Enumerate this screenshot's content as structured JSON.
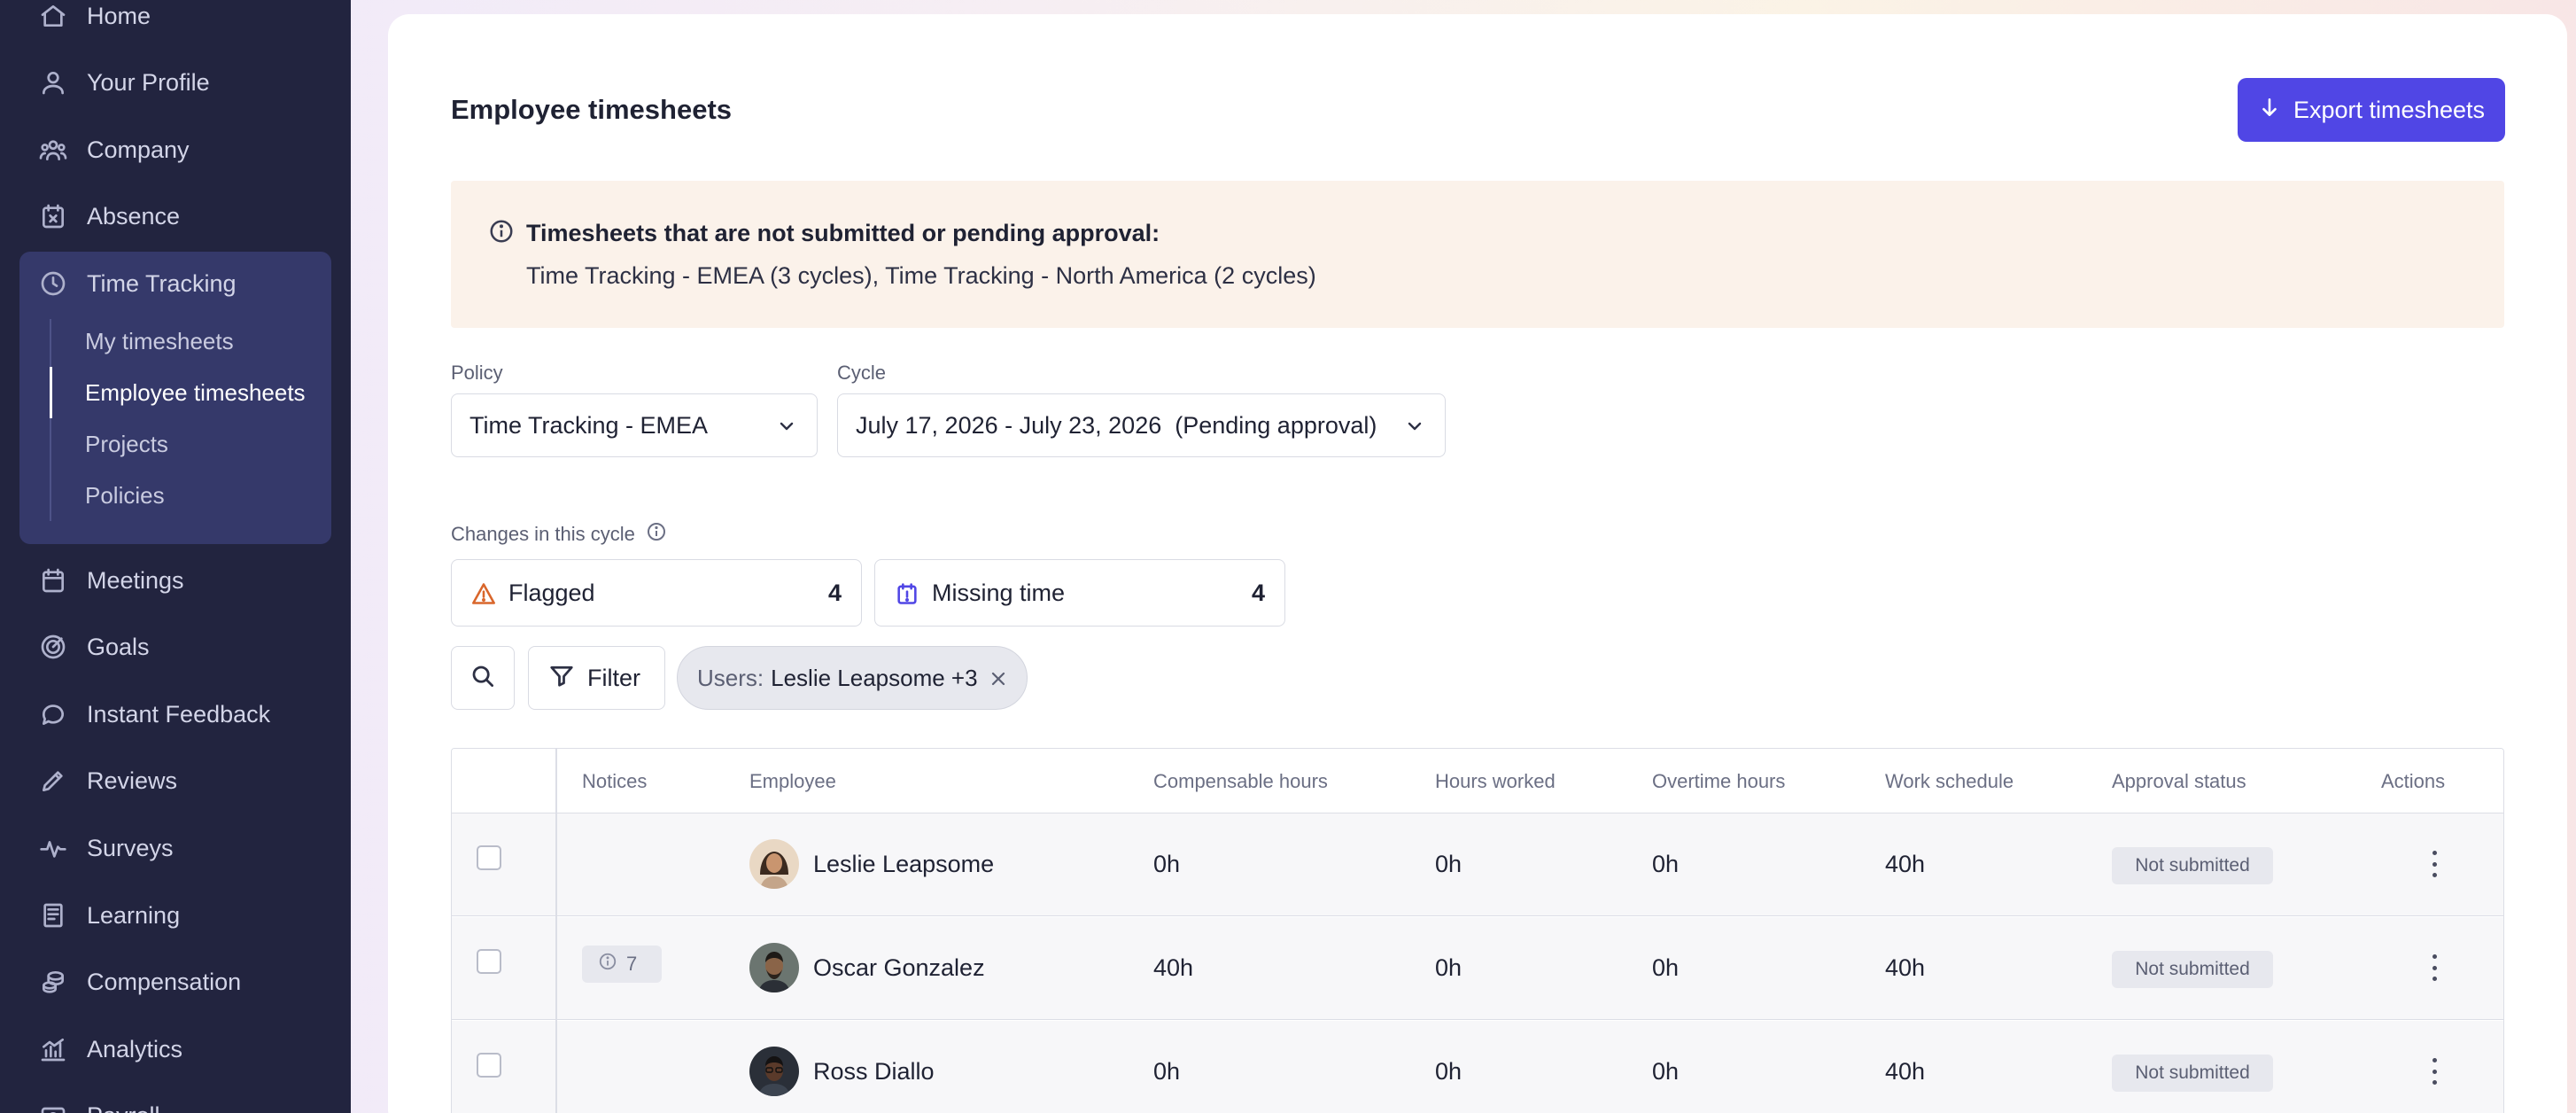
{
  "sidebar": {
    "items": [
      {
        "label": "Home",
        "icon": "home-icon"
      },
      {
        "label": "Your Profile",
        "icon": "user-icon"
      },
      {
        "label": "Company",
        "icon": "users-icon"
      },
      {
        "label": "Absence",
        "icon": "calendar-x-icon"
      },
      {
        "label": "Time Tracking",
        "icon": "clock-icon"
      },
      {
        "label": "Meetings",
        "icon": "calendar-icon"
      },
      {
        "label": "Goals",
        "icon": "target-icon"
      },
      {
        "label": "Instant Feedback",
        "icon": "message-icon"
      },
      {
        "label": "Reviews",
        "icon": "pencil-icon"
      },
      {
        "label": "Surveys",
        "icon": "pulse-icon"
      },
      {
        "label": "Learning",
        "icon": "book-icon"
      },
      {
        "label": "Compensation",
        "icon": "coins-icon"
      },
      {
        "label": "Analytics",
        "icon": "chart-icon"
      },
      {
        "label": "Payroll",
        "icon": "payroll-icon"
      }
    ],
    "time_tracking_sub": [
      {
        "label": "My timesheets",
        "active": false
      },
      {
        "label": "Employee timesheets",
        "active": true
      },
      {
        "label": "Projects",
        "active": false
      },
      {
        "label": "Policies",
        "active": false
      }
    ]
  },
  "header": {
    "title": "Employee timesheets",
    "export_label": "Export timesheets",
    "accent_color": "#5046e5"
  },
  "notice": {
    "title": "Timesheets that are not submitted or pending approval:",
    "body": "Time Tracking - EMEA (3 cycles), Time Tracking - North America (2 cycles)"
  },
  "filters": {
    "policy_label": "Policy",
    "policy_value": "Time Tracking - EMEA",
    "cycle_label": "Cycle",
    "cycle_value": "July 17, 2026 - July 23, 2026  (Pending approval)",
    "changes_label": "Changes in this cycle",
    "flagged_label": "Flagged",
    "flagged_count": "4",
    "missing_label": "Missing time",
    "missing_count": "4",
    "filter_label": "Filter",
    "chip_key": "Users:",
    "chip_value": "Leslie Leapsome +3"
  },
  "table": {
    "headers": {
      "notices": "Notices",
      "employee": "Employee",
      "compensable": "Compensable hours",
      "worked": "Hours worked",
      "overtime": "Overtime hours",
      "schedule": "Work schedule",
      "status": "Approval status",
      "actions": "Actions"
    },
    "rows": [
      {
        "notice": "",
        "name": "Leslie Leapsome",
        "compensable": "0h",
        "worked": "0h",
        "overtime": "0h",
        "schedule": "40h",
        "status": "Not submitted"
      },
      {
        "notice": "7",
        "name": "Oscar Gonzalez",
        "compensable": "40h",
        "worked": "0h",
        "overtime": "0h",
        "schedule": "40h",
        "status": "Not submitted"
      },
      {
        "notice": "",
        "name": "Ross Diallo",
        "compensable": "0h",
        "worked": "0h",
        "overtime": "0h",
        "schedule": "40h",
        "status": "Not submitted"
      }
    ]
  }
}
